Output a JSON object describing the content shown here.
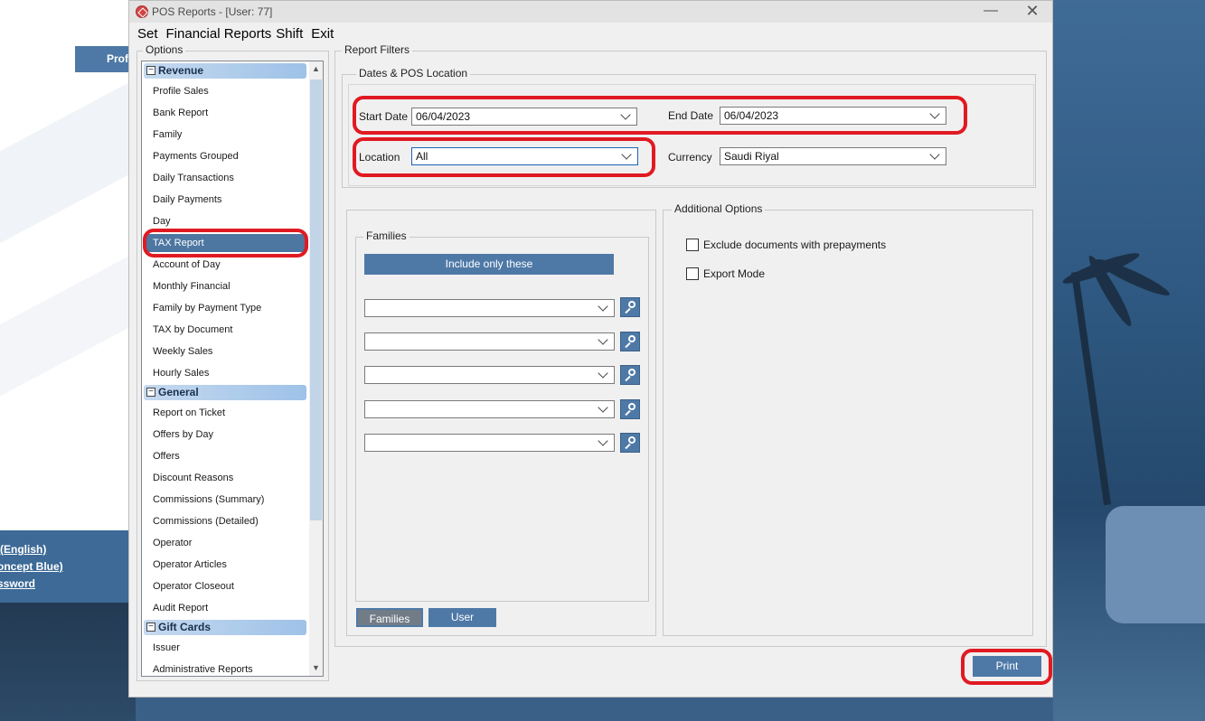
{
  "window": {
    "title": "POS Reports - [User: 77]",
    "minimize_glyph": "—",
    "close_glyph": "✕"
  },
  "menu": {
    "items": [
      "Set",
      "Financial Reports",
      "Shift",
      "Exit"
    ]
  },
  "background": {
    "left_tab_label": "Profi",
    "links": [
      "(English)",
      "oncept Blue)",
      "ssword"
    ]
  },
  "options": {
    "legend": "Options",
    "categories": [
      {
        "label": "Revenue",
        "toggle": "−"
      },
      {
        "label": "General",
        "toggle": "−"
      },
      {
        "label": "Gift Cards",
        "toggle": "−"
      }
    ],
    "revenue_items": [
      "Profile Sales",
      "Bank Report",
      "Family",
      "Payments Grouped",
      "Daily Transactions",
      "Daily Payments",
      "Day",
      "TAX Report",
      "Account of Day",
      "Monthly Financial",
      "Family by Payment Type",
      "TAX by Document",
      "Weekly Sales",
      "Hourly Sales"
    ],
    "general_items": [
      "Report on Ticket",
      "Offers by Day",
      "Offers",
      "Discount Reasons",
      "Commissions (Summary)",
      "Commissions (Detailed)",
      "Operator",
      "Operator Articles",
      "Operator Closeout",
      "Audit Report"
    ],
    "giftcard_items": [
      "Issuer",
      "Administrative Reports"
    ],
    "selected": "TAX Report",
    "scroll_up": "▲",
    "scroll_down": "▼"
  },
  "filters": {
    "legend": "Report Filters",
    "dates_legend": "Dates & POS Location",
    "start_date_label": "Start Date",
    "start_date_value": "06/04/2023",
    "end_date_label": "End Date",
    "end_date_value": "06/04/2023",
    "location_label": "Location",
    "location_value": "All",
    "currency_label": "Currency",
    "currency_value": "Saudi Riyal"
  },
  "families": {
    "legend": "Families",
    "include_button": "Include only these",
    "combos": [
      "",
      "",
      "",
      "",
      ""
    ],
    "tab_families": "Families",
    "tab_user": "User"
  },
  "additional": {
    "legend": "Additional Options",
    "exclude_prepayments": "Exclude documents with prepayments",
    "export_mode": "Export Mode"
  },
  "actions": {
    "print": "Print"
  },
  "colors": {
    "accent": "#4e79a7",
    "selected": "#4d76a1",
    "highlight": "#e01a22"
  }
}
